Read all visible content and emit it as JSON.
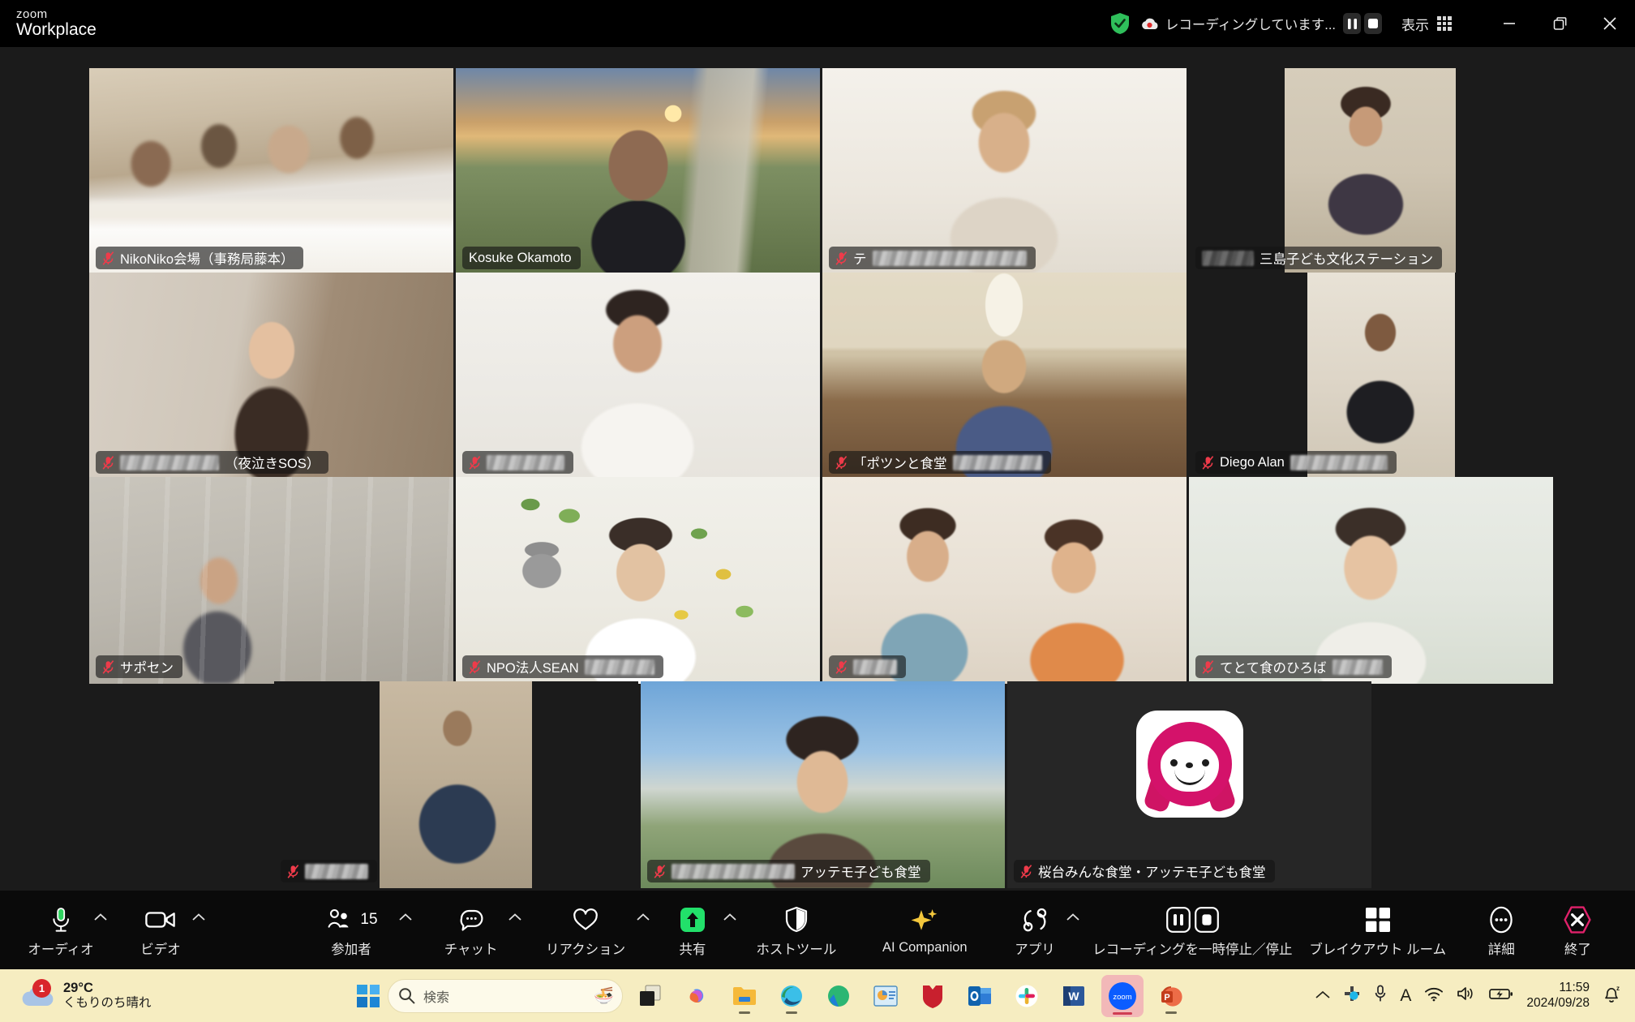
{
  "app": {
    "brand_top": "zoom",
    "brand_bottom": "Workplace"
  },
  "titlebar": {
    "shield_icon": "shield-check-icon",
    "recording_cloud_icon": "cloud-recording-icon",
    "recording_text": "レコーディングしています...",
    "pause_icon": "pause-icon",
    "stop_icon": "stop-icon",
    "view_label": "表示",
    "view_grid_icon": "grid-view-icon",
    "minimize_icon": "minimize-icon",
    "restore_icon": "restore-window-icon",
    "close_icon": "close-icon"
  },
  "gallery": {
    "active_speaker": "Kosuke Okamoto",
    "active_border_color": "#22e06a",
    "mute_icon": "microphone-muted-icon",
    "participants": [
      {
        "id": "p1",
        "name": "NikoNiko会場（事務局藤本）",
        "muted": true,
        "active": false,
        "redacted": false
      },
      {
        "id": "p2",
        "name": "Kosuke Okamoto",
        "muted": false,
        "active": true,
        "redacted": false
      },
      {
        "id": "p3",
        "name": "テ",
        "muted": true,
        "active": false,
        "redacted": true
      },
      {
        "id": "p4",
        "name": "三島子ども文化ステーション",
        "muted": false,
        "active": false,
        "redacted": true
      },
      {
        "id": "p5",
        "name": "（夜泣きSOS）",
        "muted": true,
        "active": false,
        "redacted": true
      },
      {
        "id": "p6",
        "name": "",
        "muted": true,
        "active": false,
        "redacted": true
      },
      {
        "id": "p7",
        "name": "「ポツンと食堂",
        "muted": true,
        "active": false,
        "redacted": true
      },
      {
        "id": "p8",
        "name": "Diego Alan",
        "muted": true,
        "active": false,
        "redacted": true
      },
      {
        "id": "p9",
        "name": "サポセン",
        "muted": true,
        "active": false,
        "redacted": false
      },
      {
        "id": "p10",
        "name": "NPO法人SEAN",
        "muted": true,
        "active": false,
        "redacted": true
      },
      {
        "id": "p11",
        "name": "",
        "muted": true,
        "active": false,
        "redacted": true
      },
      {
        "id": "p12",
        "name": "てとて食のひろば",
        "muted": true,
        "active": false,
        "redacted": true
      },
      {
        "id": "p13",
        "name": "",
        "muted": true,
        "active": false,
        "redacted": true
      },
      {
        "id": "p14",
        "name": "アッテモ子ども食堂",
        "muted": true,
        "active": false,
        "redacted": true
      },
      {
        "id": "p15",
        "name": "桜台みんな食堂・アッテモ子ども食堂",
        "muted": true,
        "active": false,
        "redacted": false
      }
    ]
  },
  "toolbar": {
    "audio_label": "オーディオ",
    "audio_icon": "microphone-icon",
    "video_label": "ビデオ",
    "video_icon": "camera-icon",
    "participants_label": "参加者",
    "participants_icon": "people-icon",
    "participants_count": "15",
    "chat_label": "チャット",
    "chat_icon": "chat-bubble-icon",
    "reactions_label": "リアクション",
    "reactions_icon": "heart-icon",
    "share_label": "共有",
    "share_icon": "share-screen-icon",
    "share_accent": "#22e06a",
    "hosttools_label": "ホストツール",
    "hosttools_icon": "shield-icon",
    "ai_label": "AI Companion",
    "ai_icon": "sparkle-icon",
    "ai_accent": "#f2c council",
    "apps_label": "アプリ",
    "apps_icon": "apps-icon",
    "recording_label": "レコーディングを一時停止／停止",
    "recording_pause_icon": "pause-icon",
    "recording_stop_icon": "stop-icon",
    "breakout_label": "ブレイクアウト ルーム",
    "breakout_icon": "breakout-rooms-icon",
    "more_label": "詳細",
    "more_icon": "ellipsis-icon",
    "end_label": "終了",
    "end_icon": "end-call-icon",
    "end_accent": "#e0216a"
  },
  "taskbar": {
    "weather_temp": "29°C",
    "weather_desc": "くもりのち晴れ",
    "weather_icon": "cloud-icon",
    "notification_count": "1",
    "start_icon": "windows-start-icon",
    "search_placeholder": "検索",
    "search_icon": "search-icon",
    "search_widget_icon": "ramen-bowl-icon",
    "apps": [
      {
        "name": "task-view-icon",
        "running": false
      },
      {
        "name": "copilot-icon",
        "running": false
      },
      {
        "name": "file-explorer-icon",
        "running": true
      },
      {
        "name": "edge-icon",
        "running": true
      },
      {
        "name": "store-icon",
        "running": false
      },
      {
        "name": "powerpoint-viewer-icon",
        "running": false
      },
      {
        "name": "mcafee-icon",
        "running": false
      },
      {
        "name": "outlook-icon",
        "running": false
      },
      {
        "name": "slack-icon",
        "running": false
      },
      {
        "name": "word-icon",
        "running": false
      },
      {
        "name": "zoom-icon",
        "running": true
      },
      {
        "name": "powerpoint-icon",
        "running": true
      }
    ],
    "tray": {
      "chevron_icon": "show-hidden-icons-icon",
      "slack_icon": "slack-tray-icon",
      "mic_icon": "microphone-tray-icon",
      "ime_icon": "ime-alphanumeric-icon",
      "wifi_icon": "wifi-icon",
      "volume_icon": "volume-icon",
      "battery_icon": "battery-charging-icon",
      "time": "11:59",
      "date": "2024/09/28",
      "notify_icon": "notifications-off-icon"
    }
  }
}
